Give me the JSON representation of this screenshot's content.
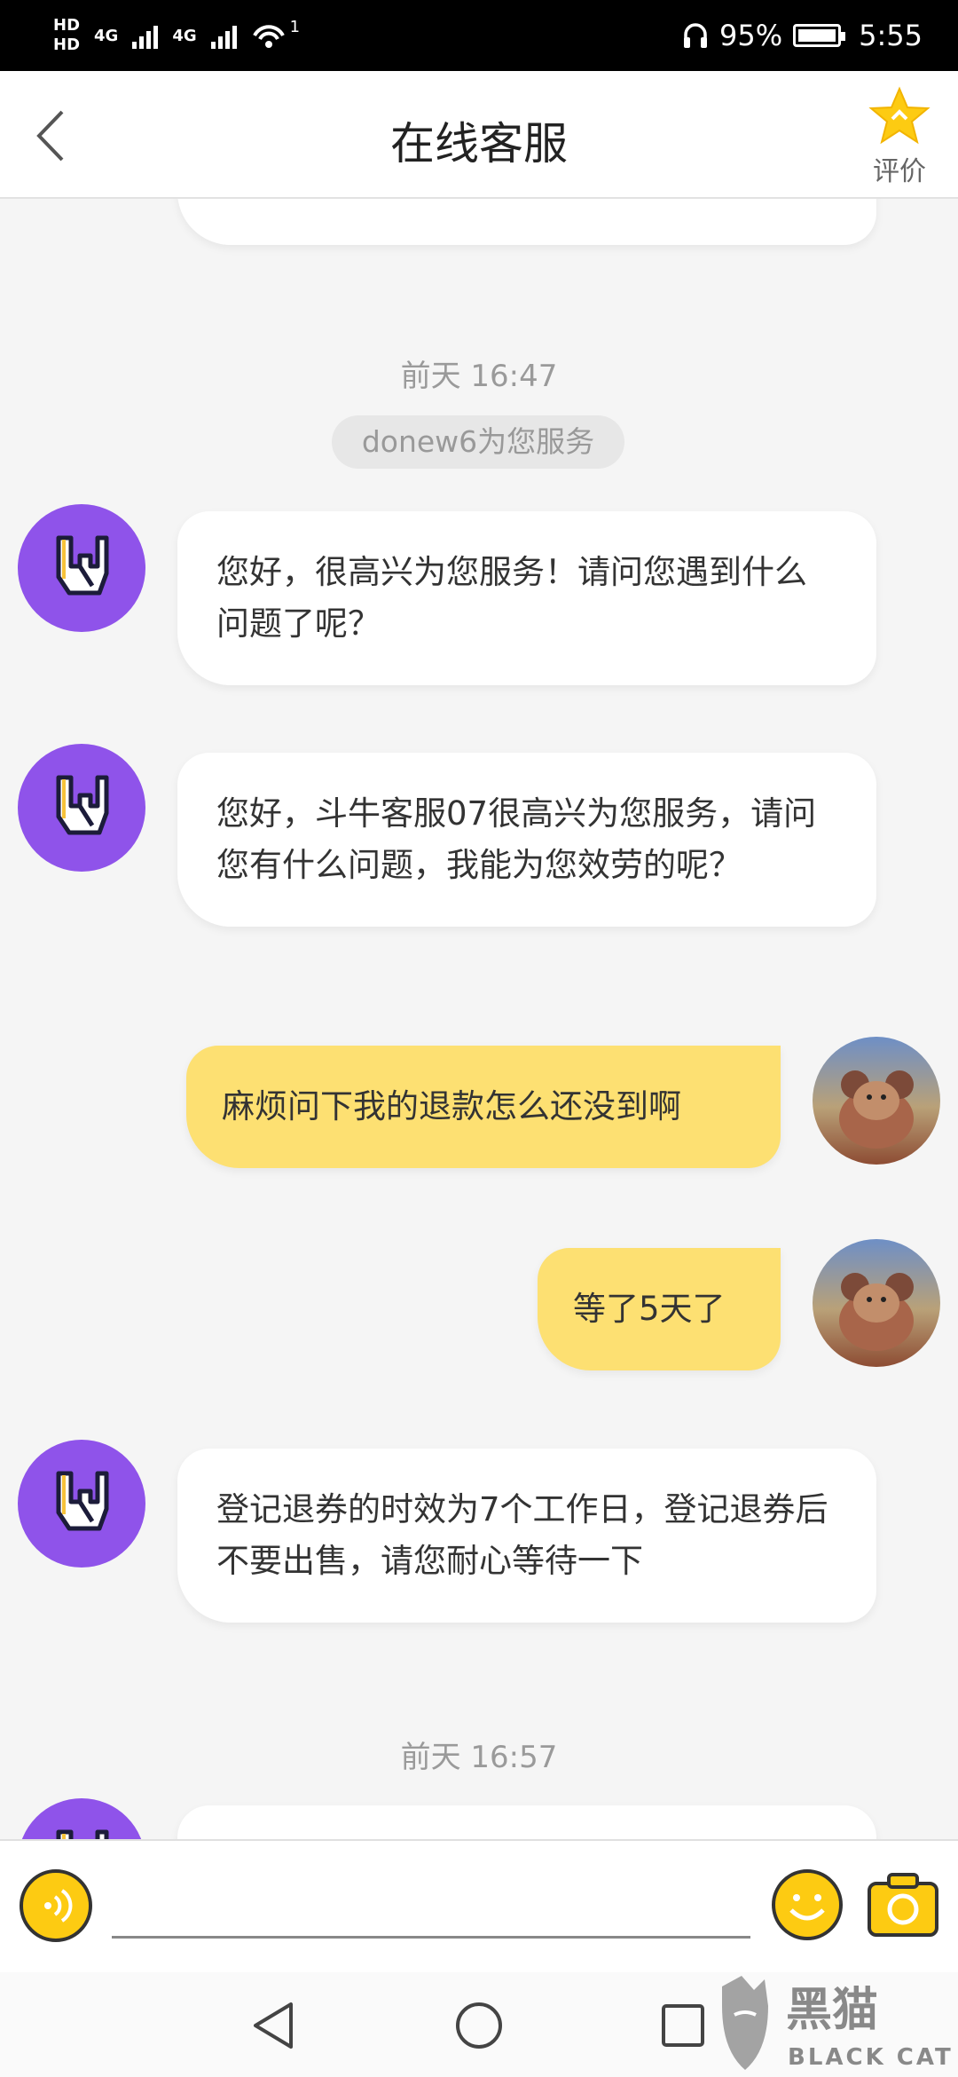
{
  "status_bar": {
    "hd1": "HD",
    "hd2": "HD",
    "net1": "4G",
    "net2": "4G",
    "wifi_badge": "1",
    "battery": "95%",
    "time": "5:55",
    "icons": [
      "headphones-icon",
      "battery-icon",
      "wifi-icon"
    ]
  },
  "header": {
    "title": "在线客服",
    "rate_label": "评价",
    "icons": [
      "back-icon",
      "star-icon"
    ]
  },
  "chat": {
    "timestamp1": "前天 16:47",
    "service_chip": "donew6为您服务",
    "messages": [
      {
        "from": "agent",
        "text": "您好，很高兴为您服务！请问您遇到什么问题了呢？"
      },
      {
        "from": "agent",
        "text": "您好，斗牛客服07很高兴为您服务，请问您有什么问题，我能为您效劳的呢？"
      },
      {
        "from": "user",
        "text": "麻烦问下我的退款怎么还没到啊"
      },
      {
        "from": "user",
        "text": "等了5天了"
      },
      {
        "from": "agent",
        "text": "登记退券的时效为7个工作日，登记退券后不要出售，请您耐心等待一下"
      }
    ],
    "timestamp2": "前天 16:57"
  },
  "input_bar": {
    "placeholder": "",
    "icons": [
      "voice-icon",
      "emoji-icon",
      "camera-icon"
    ]
  },
  "nav_bar": {
    "icons": [
      "nav-back-icon",
      "nav-home-icon",
      "nav-recents-icon"
    ]
  },
  "watermark": {
    "text": "黑猫",
    "subtext": "BLACK CAT"
  },
  "colors": {
    "user_bubble": "#fde072",
    "agent_avatar": "#8f53ea",
    "accent_yellow": "#fdcb12"
  }
}
